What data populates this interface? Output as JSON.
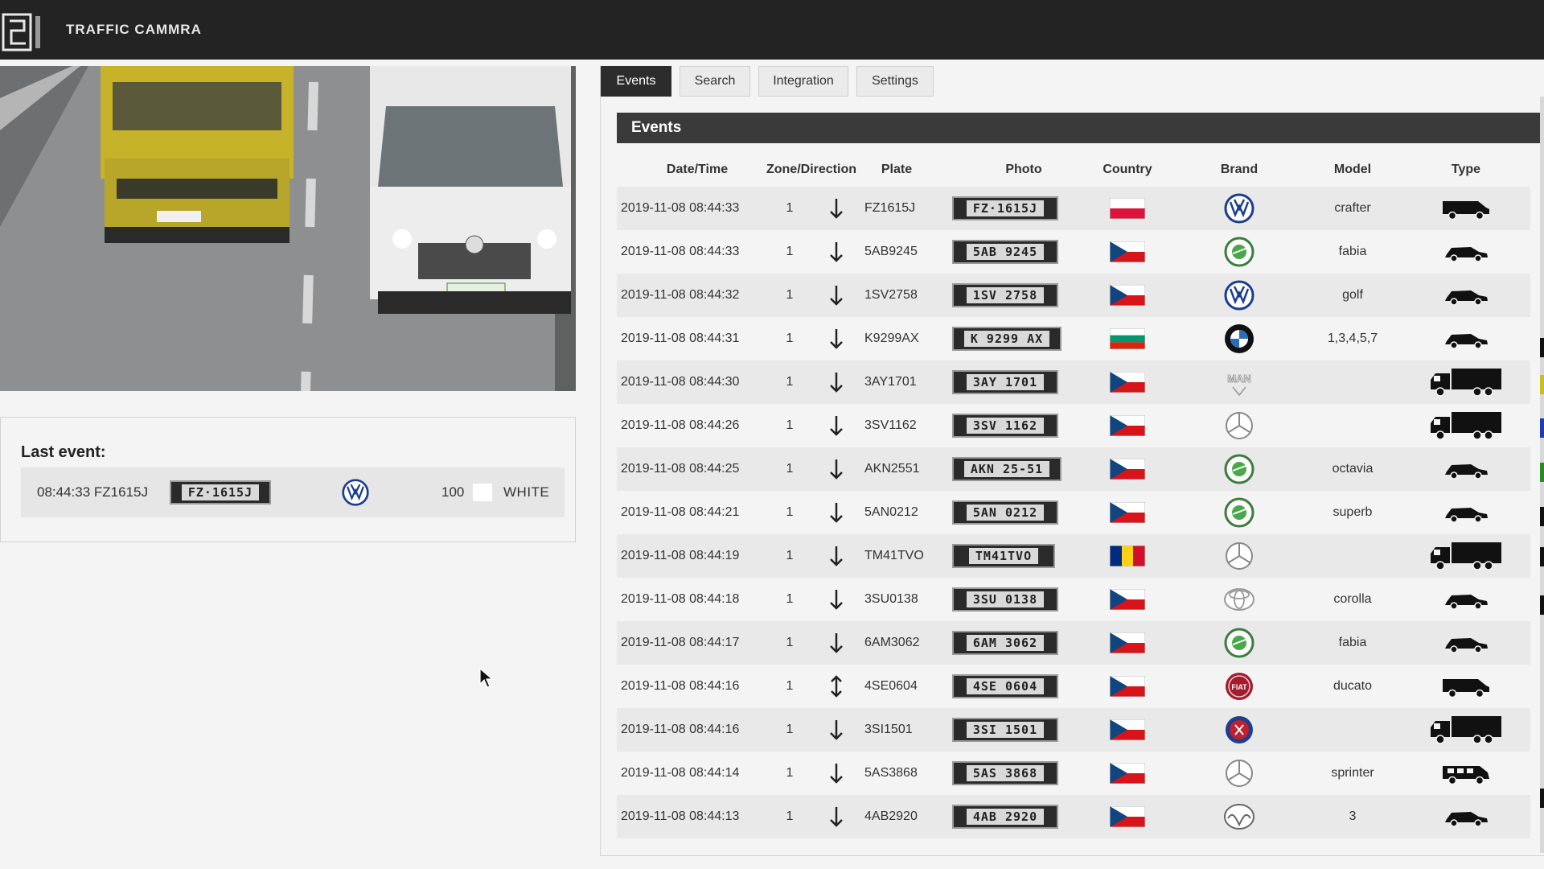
{
  "app": {
    "title": "TRAFFIC CAMMRA"
  },
  "tabs": [
    {
      "label": "Events",
      "active": true
    },
    {
      "label": "Search",
      "active": false
    },
    {
      "label": "Integration",
      "active": false
    },
    {
      "label": "Settings",
      "active": false
    }
  ],
  "events_panel": {
    "title": "Events"
  },
  "columns": [
    "Date/Time",
    "Zone/Direction",
    "Plate",
    "Photo",
    "Country",
    "Brand",
    "Model",
    "Type"
  ],
  "last_event": {
    "title": "Last event:",
    "time_plate": "08:44:33 FZ1615J",
    "plate_photo": "FZ·1615J",
    "brand": "vw-logo",
    "confidence": "100",
    "color_name": "WHITE",
    "color_swatch": "#ffffff"
  },
  "events": [
    {
      "datetime": "2019-11-08 08:44:33",
      "zone": "1",
      "direction": "down-arrow-icon",
      "plate": "FZ1615J",
      "photo": "FZ·1615J",
      "country": "PL",
      "brand": "vw-logo",
      "model": "crafter",
      "type": "van-icon"
    },
    {
      "datetime": "2019-11-08 08:44:33",
      "zone": "1",
      "direction": "down-arrow-icon",
      "plate": "5AB9245",
      "photo": "5AB 9245",
      "country": "CZ",
      "brand": "skoda-logo",
      "model": "fabia",
      "type": "car-icon"
    },
    {
      "datetime": "2019-11-08 08:44:32",
      "zone": "1",
      "direction": "down-arrow-icon",
      "plate": "1SV2758",
      "photo": "1SV 2758",
      "country": "CZ",
      "brand": "vw-logo",
      "model": "golf",
      "type": "car-icon"
    },
    {
      "datetime": "2019-11-08 08:44:31",
      "zone": "1",
      "direction": "down-arrow-icon",
      "plate": "K9299AX",
      "photo": "K 9299 AX",
      "country": "BG",
      "brand": "bmw-logo",
      "model": "1,3,4,5,7",
      "type": "car-icon"
    },
    {
      "datetime": "2019-11-08 08:44:30",
      "zone": "1",
      "direction": "down-arrow-icon",
      "plate": "3AY1701",
      "photo": "3AY 1701",
      "country": "CZ",
      "brand": "man-logo",
      "model": "",
      "type": "truck-icon"
    },
    {
      "datetime": "2019-11-08 08:44:26",
      "zone": "1",
      "direction": "down-arrow-icon",
      "plate": "3SV1162",
      "photo": "3SV 1162",
      "country": "CZ",
      "brand": "mercedes-logo",
      "model": "",
      "type": "truck-icon"
    },
    {
      "datetime": "2019-11-08 08:44:25",
      "zone": "1",
      "direction": "down-arrow-icon",
      "plate": "AKN2551",
      "photo": "AKN 25-51",
      "country": "CZ",
      "brand": "skoda-logo",
      "model": "octavia",
      "type": "car-icon"
    },
    {
      "datetime": "2019-11-08 08:44:21",
      "zone": "1",
      "direction": "down-arrow-icon",
      "plate": "5AN0212",
      "photo": "5AN 0212",
      "country": "CZ",
      "brand": "skoda-logo",
      "model": "superb",
      "type": "car-icon"
    },
    {
      "datetime": "2019-11-08 08:44:19",
      "zone": "1",
      "direction": "down-arrow-icon",
      "plate": "TM41TVO",
      "photo": "TM41TVO",
      "country": "RO",
      "brand": "mercedes-logo",
      "model": "",
      "type": "truck-icon"
    },
    {
      "datetime": "2019-11-08 08:44:18",
      "zone": "1",
      "direction": "down-arrow-icon",
      "plate": "3SU0138",
      "photo": "3SU 0138",
      "country": "CZ",
      "brand": "toyota-logo",
      "model": "corolla",
      "type": "car-icon"
    },
    {
      "datetime": "2019-11-08 08:44:17",
      "zone": "1",
      "direction": "down-arrow-icon",
      "plate": "6AM3062",
      "photo": "6AM 3062",
      "country": "CZ",
      "brand": "skoda-logo",
      "model": "fabia",
      "type": "car-icon"
    },
    {
      "datetime": "2019-11-08 08:44:16",
      "zone": "1",
      "direction": "up-down-arrow-icon",
      "plate": "4SE0604",
      "photo": "4SE 0604",
      "country": "CZ",
      "brand": "fiat-logo",
      "model": "ducato",
      "type": "van-icon"
    },
    {
      "datetime": "2019-11-08 08:44:16",
      "zone": "1",
      "direction": "down-arrow-icon",
      "plate": "3SI1501",
      "photo": "3SI 1501",
      "country": "CZ",
      "brand": "scania-logo",
      "model": "",
      "type": "truck-icon"
    },
    {
      "datetime": "2019-11-08 08:44:14",
      "zone": "1",
      "direction": "down-arrow-icon",
      "plate": "5AS3868",
      "photo": "5AS 3868",
      "country": "CZ",
      "brand": "mercedes-logo",
      "model": "sprinter",
      "type": "minibus-icon"
    },
    {
      "datetime": "2019-11-08 08:44:13",
      "zone": "1",
      "direction": "down-arrow-icon",
      "plate": "4AB2920",
      "photo": "4AB 2920",
      "country": "CZ",
      "brand": "mazda-logo",
      "model": "3",
      "type": "car-icon"
    }
  ],
  "colors": {
    "topbar": "#232323",
    "header": "#3a3a3a",
    "active_tab": "#2c2c2c"
  }
}
